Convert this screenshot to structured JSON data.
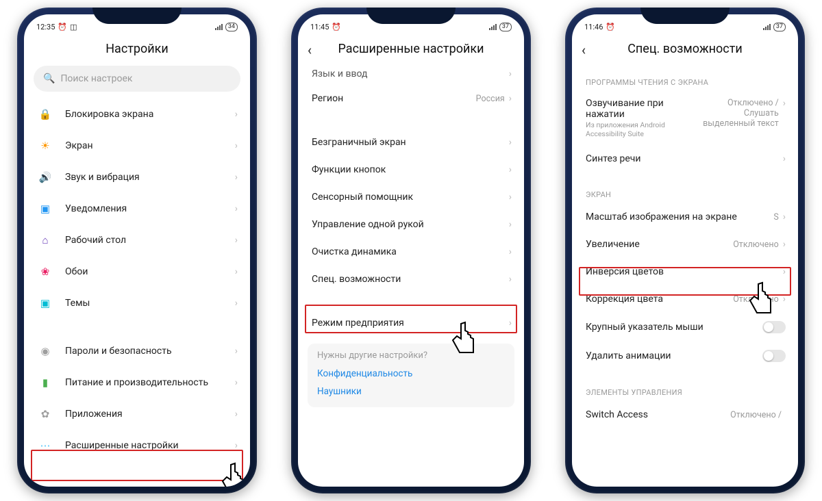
{
  "phone1": {
    "time": "12:35",
    "battery": "34",
    "title": "Настройки",
    "search_placeholder": "Поиск настроек",
    "group1": [
      {
        "icon": "🔒",
        "color": "#f44336",
        "label": "Блокировка экрана"
      },
      {
        "icon": "☀",
        "color": "#ff9800",
        "label": "Экран"
      },
      {
        "icon": "🔊",
        "color": "#4caf50",
        "label": "Звук и вибрация"
      },
      {
        "icon": "✉",
        "color": "#2196f3",
        "label": "Уведомления"
      },
      {
        "icon": "⌂",
        "color": "#673ab7",
        "label": "Рабочий стол"
      },
      {
        "icon": "❀",
        "color": "#e91e63",
        "label": "Обои"
      },
      {
        "icon": "▣",
        "color": "#00bcd4",
        "label": "Темы"
      }
    ],
    "group2": [
      {
        "icon": "◉",
        "color": "#9e9e9e",
        "label": "Пароли и безопасность"
      },
      {
        "icon": "▮",
        "color": "#4caf50",
        "label": "Питание и производительность"
      },
      {
        "icon": "✿",
        "color": "#9e9e9e",
        "label": "Приложения"
      },
      {
        "icon": "⋯",
        "color": "#90caf9",
        "label": "Расширенные настройки"
      }
    ]
  },
  "phone2": {
    "time": "11:45",
    "battery": "37",
    "title": "Расширенные настройки",
    "rows": [
      {
        "label": "Язык и ввод"
      },
      {
        "label": "Регион",
        "value": "Россия"
      }
    ],
    "rows2": [
      {
        "label": "Безграничный экран"
      },
      {
        "label": "Функции кнопок"
      },
      {
        "label": "Сенсорный помощник"
      },
      {
        "label": "Управление одной рукой"
      },
      {
        "label": "Очистка динамика"
      },
      {
        "label": "Спец. возможности"
      }
    ],
    "rows3": [
      {
        "label": "Режим предприятия"
      }
    ],
    "footer_q": "Нужны другие настройки?",
    "footer_links": [
      "Конфиденциальность",
      "Наушники"
    ]
  },
  "phone3": {
    "time": "11:46",
    "battery": "37",
    "title": "Спец. возможности",
    "sec1_label": "ПРОГРАММЫ ЧТЕНИЯ С ЭКРАНА",
    "r1_title": "Озвучивание при нажатии",
    "r1_sub": "Из приложения Android Accessibility Suite",
    "r1_val": "Отключено / Слушать выделенный текст",
    "r2_label": "Синтез речи",
    "sec2_label": "ЭКРАН",
    "r3_label": "Масштаб изображения на экране",
    "r3_val": "S",
    "r4_label": "Увеличение",
    "r4_val": "Отключено",
    "r5_label": "Инверсия цветов",
    "r6_label": "Коррекция цвета",
    "r6_val": "Отключено",
    "r7_label": "Крупный указатель мыши",
    "r8_label": "Удалить анимации",
    "sec3_label": "ЭЛЕМЕНТЫ УПРАВЛЕНИЯ",
    "r9_label": "Switch Access",
    "r9_val": "Отключено /"
  }
}
